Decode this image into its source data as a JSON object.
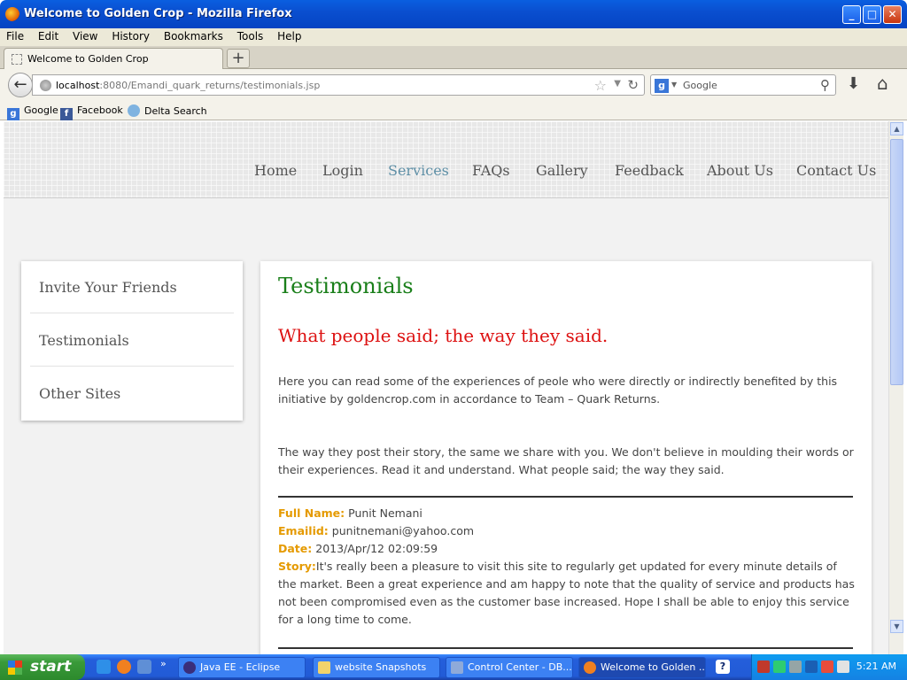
{
  "window": {
    "title": "Welcome to Golden Crop - Mozilla Firefox"
  },
  "menu": [
    "File",
    "Edit",
    "View",
    "History",
    "Bookmarks",
    "Tools",
    "Help"
  ],
  "tab": {
    "label": "Welcome to Golden Crop"
  },
  "address": {
    "host": "localhost",
    "rest": ":8080/Emandi_quark_returns/testimonials.jsp"
  },
  "search": {
    "placeholder": "Google"
  },
  "bookmarks": [
    "Google",
    "Facebook",
    "Delta Search"
  ],
  "site": {
    "nav": [
      "Home",
      "Login",
      "Services",
      "FAQs",
      "Gallery",
      "Feedback",
      "About Us",
      "Contact Us"
    ],
    "active_nav": "Services",
    "sidebar": [
      "Invite Your Friends",
      "Testimonials",
      "Other Sites"
    ],
    "title": "Testimonials",
    "subtitle": "What people said; the way they said.",
    "para1": "Here you can read some of the experiences of peole who were directly or indirectly benefited by this initiative by goldencrop.com in accordance to Team – Quark Returns.",
    "para2": "The way they post their story, the same we share with you. We don't believe in moulding their words or their experiences. Read it and understand. What people said; the way they said.",
    "entry": {
      "name_label": "Full Name:",
      "name": "Punit Nemani",
      "email_label": "Emailid:",
      "email": "punitnemani@yahoo.com",
      "date_label": "Date:",
      "date": "2013/Apr/12 02:09:59",
      "story_label": "Story:",
      "story": "It's really been a pleasure to visit this site to regularly get updated for every minute details of the market. Been a great experience and am happy to note that the quality of service and products has not been compromised even as the customer base increased. Hope I shall be able to enjoy this service for a long time to come."
    },
    "colors": {
      "title": "#1a7f1a",
      "subtitle": "#dd1111",
      "label": "#e59a00",
      "active_nav": "#5e8fa6"
    }
  },
  "taskbar": {
    "start": "start",
    "items": [
      "Java EE - Eclipse",
      "website Snapshots",
      "Control Center - DB...",
      "Welcome to Golden ..."
    ],
    "clock": "5:21 AM"
  }
}
